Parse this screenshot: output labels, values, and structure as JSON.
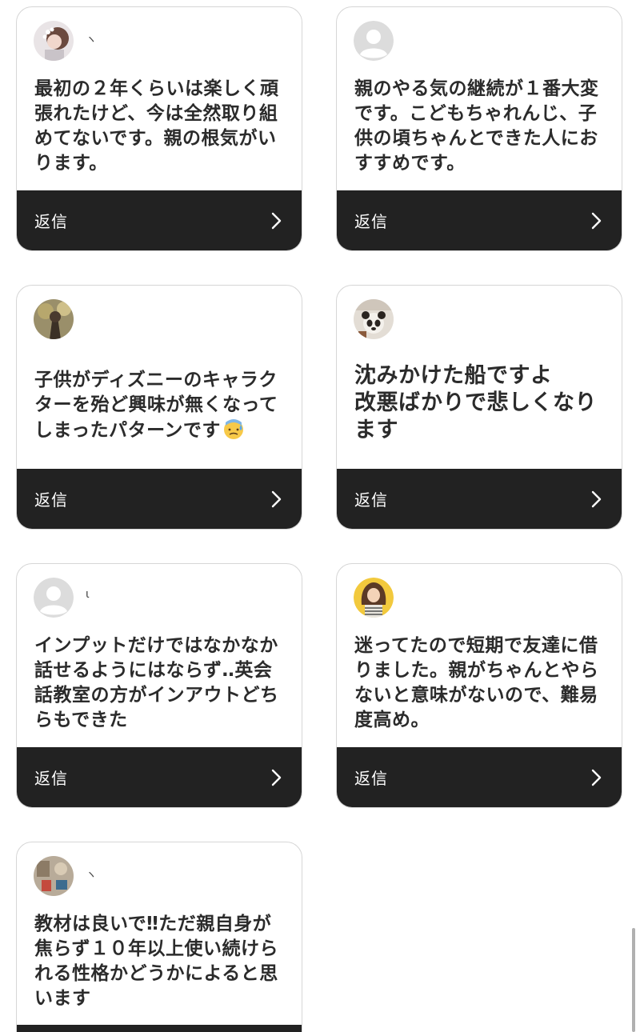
{
  "reply_label": "返信",
  "cards": [
    {
      "username": "ヽ",
      "avatar": "photo-avatar-girl-icon",
      "comment": "最初の２年くらいは楽しく頑\n張れたけど、今は全然取り組\nめてないです。親の根気がい\nります。"
    },
    {
      "username": "",
      "avatar": "default-user-icon",
      "comment": "親のやる気の継続が１番大変\nです。こどもちゃれんじ、子\n供の頃ちゃんとできた人にお\nすすめです。"
    },
    {
      "username": "",
      "avatar": "photo-avatar-tree-icon",
      "comment": "子供がディズニーのキャラク\nターを殆ど興味が無くなって\nしまったパターンです",
      "emoji": "sweat-face-emoji-icon"
    },
    {
      "username": "",
      "avatar": "photo-avatar-panda-icon",
      "comment": "沈みかけた船ですよ\n改悪ばかりで悲しくなり\nます"
    },
    {
      "username": "ι",
      "avatar": "default-user-icon",
      "comment": "インプットだけではなかなか\n話せるようにはならず‥英会\n話教室の方がインアウトどち\nらもできた"
    },
    {
      "username": "",
      "avatar": "photo-avatar-woman-icon",
      "comment": "迷ってたので短期で友達に借\nりました。親がちゃんとやら\nないと意味がないので、難易\n度高め。"
    },
    {
      "username": "ヽ",
      "avatar": "photo-avatar-items-icon",
      "comment": "教材は良いで‼ただ親自身が\n焦らず１０年以上使い続けら\nれる性格かどうかによると思\nいます"
    }
  ],
  "colors": {
    "reply_bar": "#222222",
    "card_border": "#d6d6d6",
    "text": "#2b2b2b"
  }
}
